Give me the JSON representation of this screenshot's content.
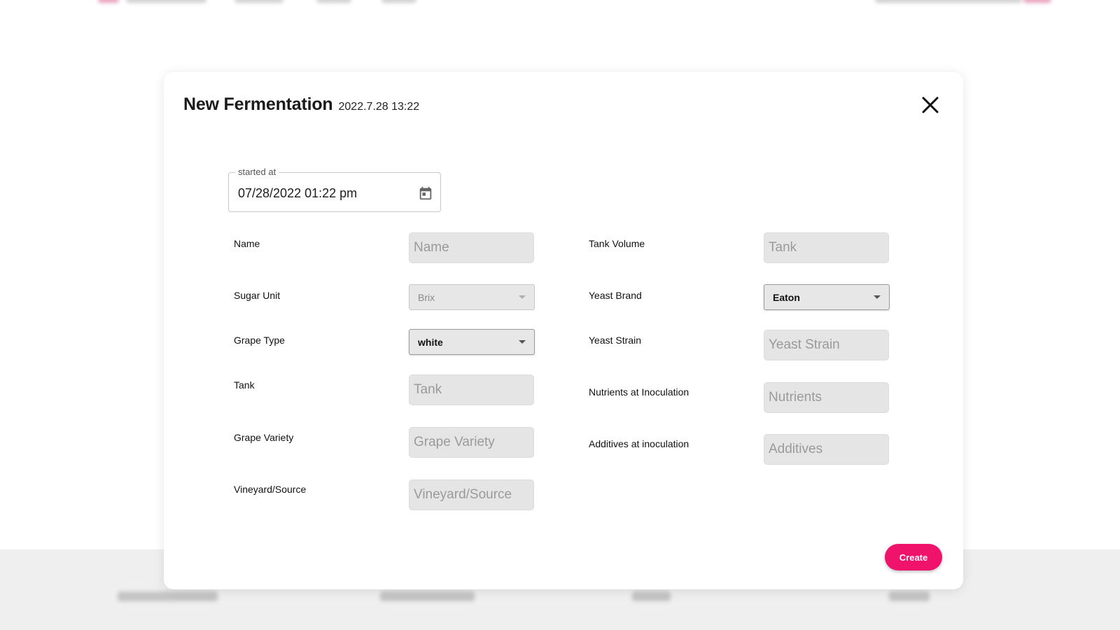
{
  "modal": {
    "title": "New Fermentation",
    "timestamp": "2022.7.28 13:22",
    "close_icon": "close-icon",
    "create_label": "Create",
    "accent_color": "#f0136b"
  },
  "started_at": {
    "label": "started at",
    "value": "07/28/2022 01:22 pm",
    "icon": "calendar-icon"
  },
  "left_fields": {
    "name": {
      "label": "Name",
      "placeholder": "Name"
    },
    "sugar_unit": {
      "label": "Sugar Unit",
      "value": "Brix",
      "disabled": true
    },
    "grape_type": {
      "label": "Grape Type",
      "value": "white"
    },
    "tank": {
      "label": "Tank",
      "placeholder": "Tank"
    },
    "grape_variety": {
      "label": "Grape Variety",
      "placeholder": "Grape Variety"
    },
    "vineyard": {
      "label": "Vineyard/Source",
      "placeholder": "Vineyard/Source"
    }
  },
  "right_fields": {
    "tank_volume": {
      "label": "Tank Volume",
      "placeholder": "Tank"
    },
    "yeast_brand": {
      "label": "Yeast Brand",
      "value": "Eaton"
    },
    "yeast_strain": {
      "label": "Yeast Strain",
      "placeholder": "Yeast Strain"
    },
    "nutrients": {
      "label": "Nutrients at Inoculation",
      "placeholder": "Nutrients"
    },
    "additives": {
      "label": "Additives at inoculation",
      "placeholder": "Additives"
    }
  }
}
